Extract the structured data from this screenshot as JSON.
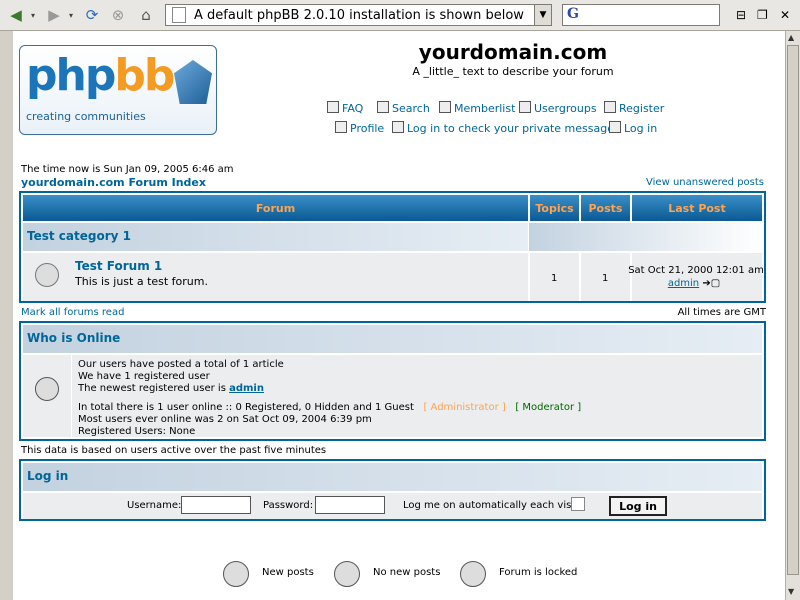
{
  "browser": {
    "address_text": "A default phpBB 2.0.10 installation is shown below",
    "search_glyph": "G"
  },
  "header": {
    "logo_word_blue": "php",
    "logo_word_orange": "bb",
    "logo_tagline": "creating communities",
    "site_title": "yourdomain.com",
    "site_description": "A _little_ text to describe your forum",
    "nav_row1": [
      "FAQ",
      "Search",
      "Memberlist",
      "Usergroups",
      "Register"
    ],
    "nav_row2": [
      "Profile",
      "Log in to check your private messages",
      "Log in"
    ]
  },
  "info": {
    "time_now": "The time now is Sun Jan 09, 2005 6:46 am",
    "forum_index": "yourdomain.com Forum Index",
    "view_unanswered": "View unanswered posts"
  },
  "forum_table": {
    "headers": {
      "forum": "Forum",
      "topics": "Topics",
      "posts": "Posts",
      "last_post": "Last Post"
    },
    "category": "Test category 1",
    "forum_name": "Test Forum 1",
    "forum_desc": "This is just a test forum.",
    "topics": "1",
    "posts": "1",
    "last_post_date": "Sat Oct 21, 2000 12:01 am",
    "last_post_user": "admin"
  },
  "below_table": {
    "mark_all": "Mark all forums read",
    "timezone": "All times are GMT"
  },
  "who_online": {
    "title": "Who is Online",
    "line1": "Our users have posted a total of 1 article",
    "line2": "We have 1 registered user",
    "line3_prefix": "The newest registered user is",
    "line3_user": "admin",
    "line4": "In total there is 1 user online :: 0 Registered, 0 Hidden and 1 Guest",
    "admin_legend": "[ Administrator ]",
    "mod_legend": "[ Moderator ]",
    "line5": "Most users ever online was 2 on Sat Oct 09, 2004 6:39 pm",
    "line6": "Registered Users: None",
    "admin_color": "#ffa34f",
    "mod_color": "#006600"
  },
  "data_info": "This data is based on users active over the past five minutes",
  "login": {
    "title": "Log in",
    "username_label": "Username:",
    "password_label": "Password:",
    "auto_label": "Log me on automatically each visit",
    "button": "Log in"
  },
  "legend": {
    "new_posts": "New posts",
    "no_new_posts": "No new posts",
    "locked": "Forum is locked"
  }
}
